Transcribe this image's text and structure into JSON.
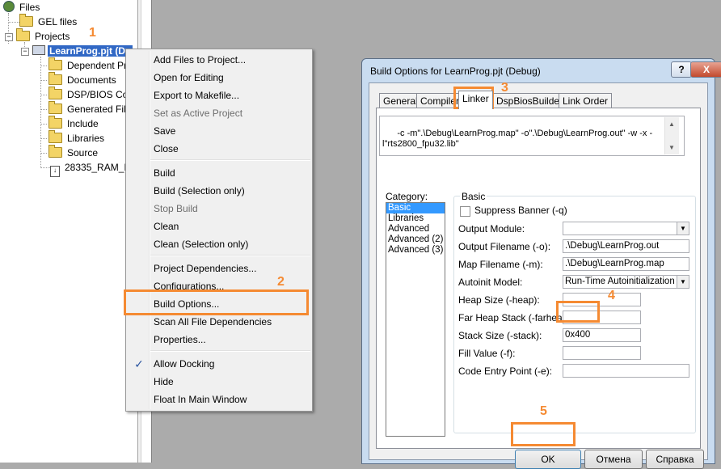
{
  "tree": {
    "files": "Files",
    "gel_files": "GEL files",
    "projects": "Projects",
    "project": "LearnProg.pjt (De",
    "folders": [
      "Dependent Pr",
      "Documents",
      "DSP/BIOS Cor",
      "Generated File",
      "Include",
      "Libraries",
      "Source"
    ],
    "file": "28335_RAM_Ir"
  },
  "context_menu": {
    "items": [
      {
        "label": "Add Files to Project...",
        "disabled": false
      },
      {
        "label": "Open for Editing",
        "disabled": false
      },
      {
        "label": "Export to Makefile...",
        "disabled": false
      },
      {
        "label": "Set as Active Project",
        "disabled": true
      },
      {
        "label": "Save",
        "disabled": false
      },
      {
        "label": "Close",
        "disabled": false
      },
      {
        "label": "Build",
        "disabled": false
      },
      {
        "label": "Build (Selection only)",
        "disabled": false
      },
      {
        "label": "Stop Build",
        "disabled": true
      },
      {
        "label": "Clean",
        "disabled": false
      },
      {
        "label": "Clean (Selection only)",
        "disabled": false
      },
      {
        "label": "Project Dependencies...",
        "disabled": false
      },
      {
        "label": "Configurations...",
        "disabled": false
      },
      {
        "label": "Build Options...",
        "disabled": false
      },
      {
        "label": "Scan All File Dependencies",
        "disabled": false
      },
      {
        "label": "Properties...",
        "disabled": false
      },
      {
        "label": "Allow Docking",
        "disabled": false,
        "checked": true
      },
      {
        "label": "Hide",
        "disabled": false
      },
      {
        "label": "Float In Main Window",
        "disabled": false
      }
    ]
  },
  "dialog": {
    "title": "Build Options for LearnProg.pjt (Debug)",
    "help_label": "?",
    "close_label": "X",
    "tabs": [
      "General",
      "Compiler",
      "Linker",
      "DspBiosBuilder",
      "Link Order"
    ],
    "active_tab": "Linker",
    "command_line": "-c -m\".\\Debug\\LearnProg.map\" -o\".\\Debug\\LearnProg.out\" -w -x -\nl\"rts2800_fpu32.lib\"",
    "category_label": "Category:",
    "categories": [
      "Basic",
      "Libraries",
      "Advanced",
      "Advanced (2)",
      "Advanced (3)"
    ],
    "group_title": "Basic",
    "suppress_banner": "Suppress Banner (-q)",
    "fields": {
      "output_module": {
        "label": "Output Module:",
        "value": ""
      },
      "output_filename": {
        "label": "Output Filename (-o):",
        "value": ".\\Debug\\LearnProg.out"
      },
      "map_filename": {
        "label": "Map Filename (-m):",
        "value": ".\\Debug\\LearnProg.map"
      },
      "autoinit_model": {
        "label": "Autoinit Model:",
        "value": "Run-Time Autoinitialization (-c"
      },
      "heap_size": {
        "label": "Heap Size (-heap):",
        "value": ""
      },
      "far_heap_stack": {
        "label": "Far Heap Stack (-farheap):",
        "value": ""
      },
      "stack_size": {
        "label": "Stack Size (-stack):",
        "value": "0x400"
      },
      "fill_value": {
        "label": "Fill Value (-f):",
        "value": ""
      },
      "code_entry_point": {
        "label": "Code Entry Point (-e):",
        "value": ""
      }
    },
    "buttons": {
      "ok": "OK",
      "cancel": "Отмена",
      "help": "Справка"
    }
  },
  "annotations": [
    "1",
    "2",
    "3",
    "4",
    "5"
  ],
  "colors": {
    "highlight": "#f58a32",
    "selection": "#3168c5",
    "listbox_selection": "#3399ff"
  }
}
